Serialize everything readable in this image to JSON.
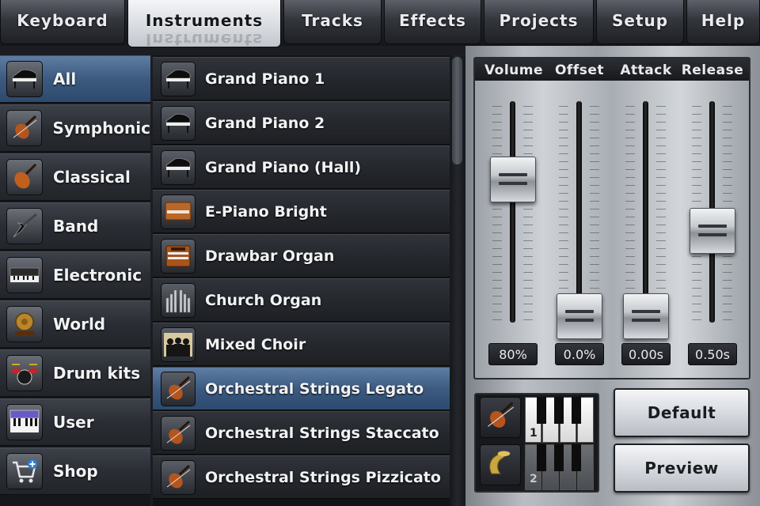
{
  "tabs": [
    {
      "label": "Keyboard",
      "active": false
    },
    {
      "label": "Instruments",
      "active": true
    },
    {
      "label": "Tracks",
      "active": false
    },
    {
      "label": "Effects",
      "active": false
    },
    {
      "label": "Projects",
      "active": false
    },
    {
      "label": "Setup",
      "active": false
    },
    {
      "label": "Help",
      "active": false
    }
  ],
  "categories": [
    {
      "label": "All",
      "icon": "grand-piano-icon",
      "selected": true
    },
    {
      "label": "Symphonic",
      "icon": "violin-bow-icon",
      "selected": false
    },
    {
      "label": "Classical",
      "icon": "violin-icon",
      "selected": false
    },
    {
      "label": "Band",
      "icon": "electric-guitar-icon",
      "selected": false
    },
    {
      "label": "Electronic",
      "icon": "synthesizer-icon",
      "selected": false
    },
    {
      "label": "World",
      "icon": "gong-icon",
      "selected": false
    },
    {
      "label": "Drum kits",
      "icon": "drum-kit-icon",
      "selected": false
    },
    {
      "label": "User",
      "icon": "user-keyboard-icon",
      "selected": false
    },
    {
      "label": "Shop",
      "icon": "shopping-cart-icon",
      "selected": false
    }
  ],
  "instruments": [
    {
      "label": "Grand Piano 1",
      "icon": "grand-piano-icon",
      "selected": false
    },
    {
      "label": "Grand Piano 2",
      "icon": "grand-piano-icon",
      "selected": false
    },
    {
      "label": "Grand Piano (Hall)",
      "icon": "grand-piano-icon",
      "selected": false
    },
    {
      "label": "E-Piano Bright",
      "icon": "electric-piano-icon",
      "selected": false
    },
    {
      "label": "Drawbar Organ",
      "icon": "organ-icon",
      "selected": false
    },
    {
      "label": "Church Organ",
      "icon": "pipe-organ-icon",
      "selected": false
    },
    {
      "label": "Mixed Choir",
      "icon": "choir-icon",
      "selected": false
    },
    {
      "label": "Orchestral Strings Legato",
      "icon": "violin-bow-icon",
      "selected": true
    },
    {
      "label": "Orchestral Strings Staccato",
      "icon": "violin-bow-icon",
      "selected": false
    },
    {
      "label": "Orchestral Strings Pizzicato",
      "icon": "violin-bow-icon",
      "selected": false
    }
  ],
  "mixer": {
    "sliders": [
      {
        "label": "Volume",
        "value": "80%",
        "level": 0.8
      },
      {
        "label": "Offset",
        "value": "0.0%",
        "level": 0.0
      },
      {
        "label": "Attack",
        "value": "0.00s",
        "level": 0.0
      },
      {
        "label": "Release",
        "value": "0.50s",
        "level": 0.5
      }
    ]
  },
  "layers": [
    {
      "number": "1",
      "icon": "violin-bow-icon",
      "active": true
    },
    {
      "number": "2",
      "icon": "tuba-icon",
      "active": false
    }
  ],
  "buttons": {
    "default_label": "Default",
    "preview_label": "Preview"
  },
  "colors": {
    "selected_row": "#3d5b81",
    "active_tab": "#d9dce1",
    "panel_silver": "#babec4"
  }
}
